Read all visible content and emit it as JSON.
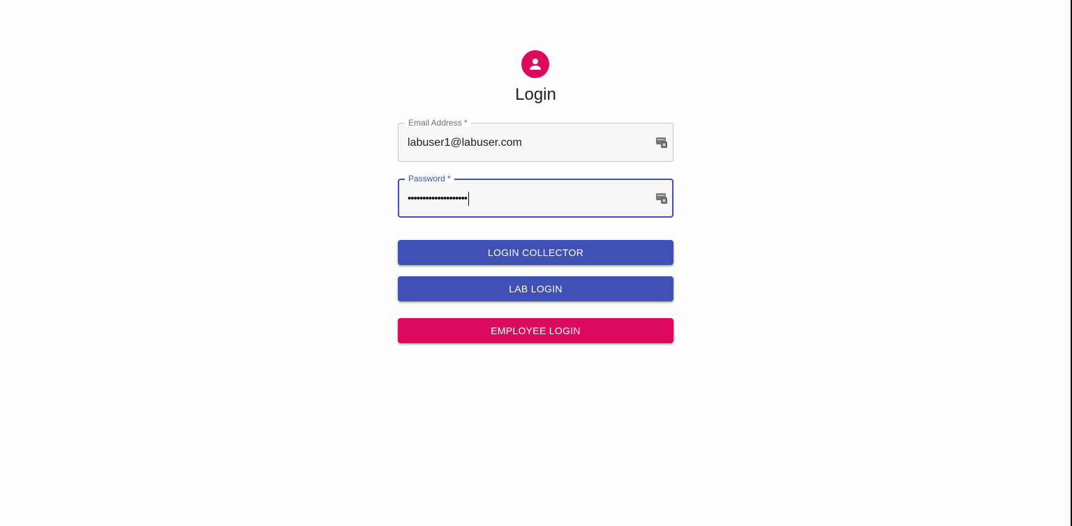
{
  "header": {
    "title": "Login",
    "avatar_icon": "account-circle-icon",
    "avatar_color": "#dc0a5d"
  },
  "form": {
    "email": {
      "label": "Email Address *",
      "value": "labuser1@labuser.com",
      "icon": "autofill-card-icon"
    },
    "password": {
      "label": "Password *",
      "masked_value": "••••••••••••••••••••",
      "icon": "autofill-card-icon"
    }
  },
  "buttons": {
    "login_collector": "LOGIN COLLECTOR",
    "lab_login": "LAB LOGIN",
    "employee_login": "EMPLOYEE LOGIN"
  },
  "colors": {
    "primary": "#3f51b5",
    "secondary": "#dc0a5d"
  }
}
